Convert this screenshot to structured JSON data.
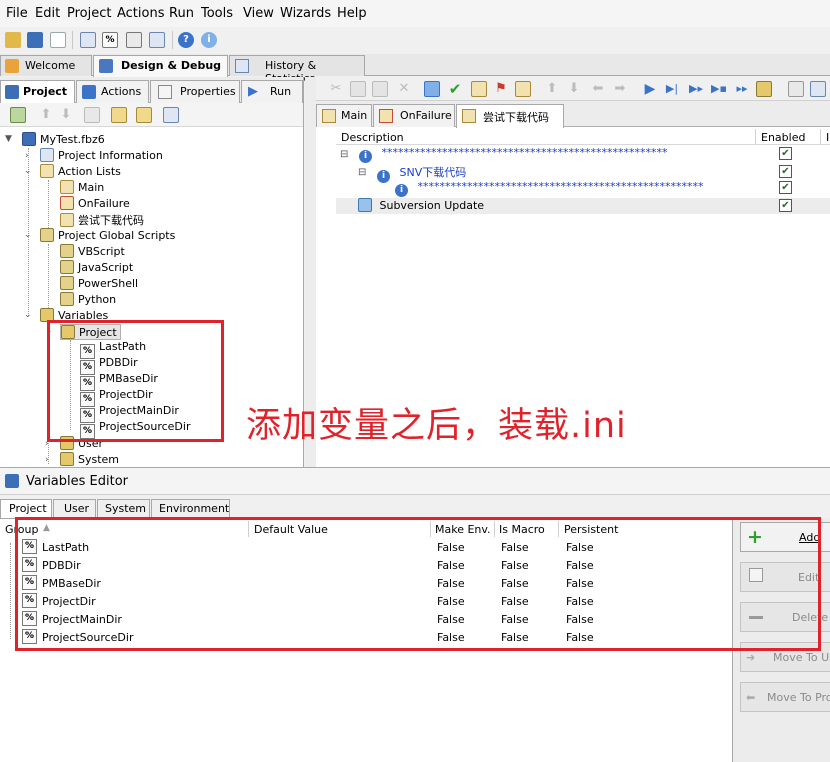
{
  "menu": [
    "File",
    "Edit",
    "Project",
    "Actions",
    "Run",
    "Tools",
    "View",
    "Wizards",
    "Help"
  ],
  "main_tabs": [
    "Welcome",
    "Design & Debug",
    "History & Statistics"
  ],
  "left_tabs": [
    "Project",
    "Actions",
    "Properties",
    "Run"
  ],
  "tree": {
    "root": "MyTest.fbz6",
    "project_information": "Project Information",
    "action_lists": "Action Lists",
    "action_list_items": [
      "Main",
      "OnFailure",
      "尝试下载代码"
    ],
    "global_scripts": "Project Global Scripts",
    "scripts": [
      "VBScript",
      "JavaScript",
      "PowerShell",
      "Python"
    ],
    "variables": "Variables",
    "project_node": "Project",
    "project_vars": [
      "LastPath",
      "PDBDir",
      "PMBaseDir",
      "ProjectDir",
      "ProjectMainDir",
      "ProjectSourceDir"
    ],
    "user_node": "User",
    "system_node": "System"
  },
  "right_tabs": [
    "Main",
    "OnFailure",
    "尝试下载代码"
  ],
  "action_grid": {
    "col_description": "Description",
    "col_enabled": "Enabled",
    "col_extra": "I",
    "rows": [
      {
        "text": "****************************************************",
        "enabled": true
      },
      {
        "text": "SNV下载代码",
        "enabled": true
      },
      {
        "text": "****************************************************",
        "enabled": true
      },
      {
        "text": "Subversion Update",
        "enabled": true
      }
    ]
  },
  "annotation": "添加变量之后，装载.ini",
  "variables_editor": {
    "title": "Variables Editor",
    "tabs": [
      "Project",
      "User",
      "System",
      "Environment"
    ],
    "columns": [
      "Group",
      "Default Value",
      "Make Env.",
      "Is Macro",
      "Persistent"
    ],
    "rows": [
      {
        "name": "LastPath",
        "make_env": "False",
        "is_macro": "False",
        "persistent": "False"
      },
      {
        "name": "PDBDir",
        "make_env": "False",
        "is_macro": "False",
        "persistent": "False"
      },
      {
        "name": "PMBaseDir",
        "make_env": "False",
        "is_macro": "False",
        "persistent": "False"
      },
      {
        "name": "ProjectDir",
        "make_env": "False",
        "is_macro": "False",
        "persistent": "False"
      },
      {
        "name": "ProjectMainDir",
        "make_env": "False",
        "is_macro": "False",
        "persistent": "False"
      },
      {
        "name": "ProjectSourceDir",
        "make_env": "False",
        "is_macro": "False",
        "persistent": "False"
      }
    ],
    "buttons": [
      "Add",
      "Edit",
      "Delete",
      "Move To Us",
      "Move To Proj"
    ]
  },
  "colors": {
    "accent_red": "#e0222b",
    "link_blue": "#1b3ec4",
    "add_green": "#2e9e2e"
  }
}
